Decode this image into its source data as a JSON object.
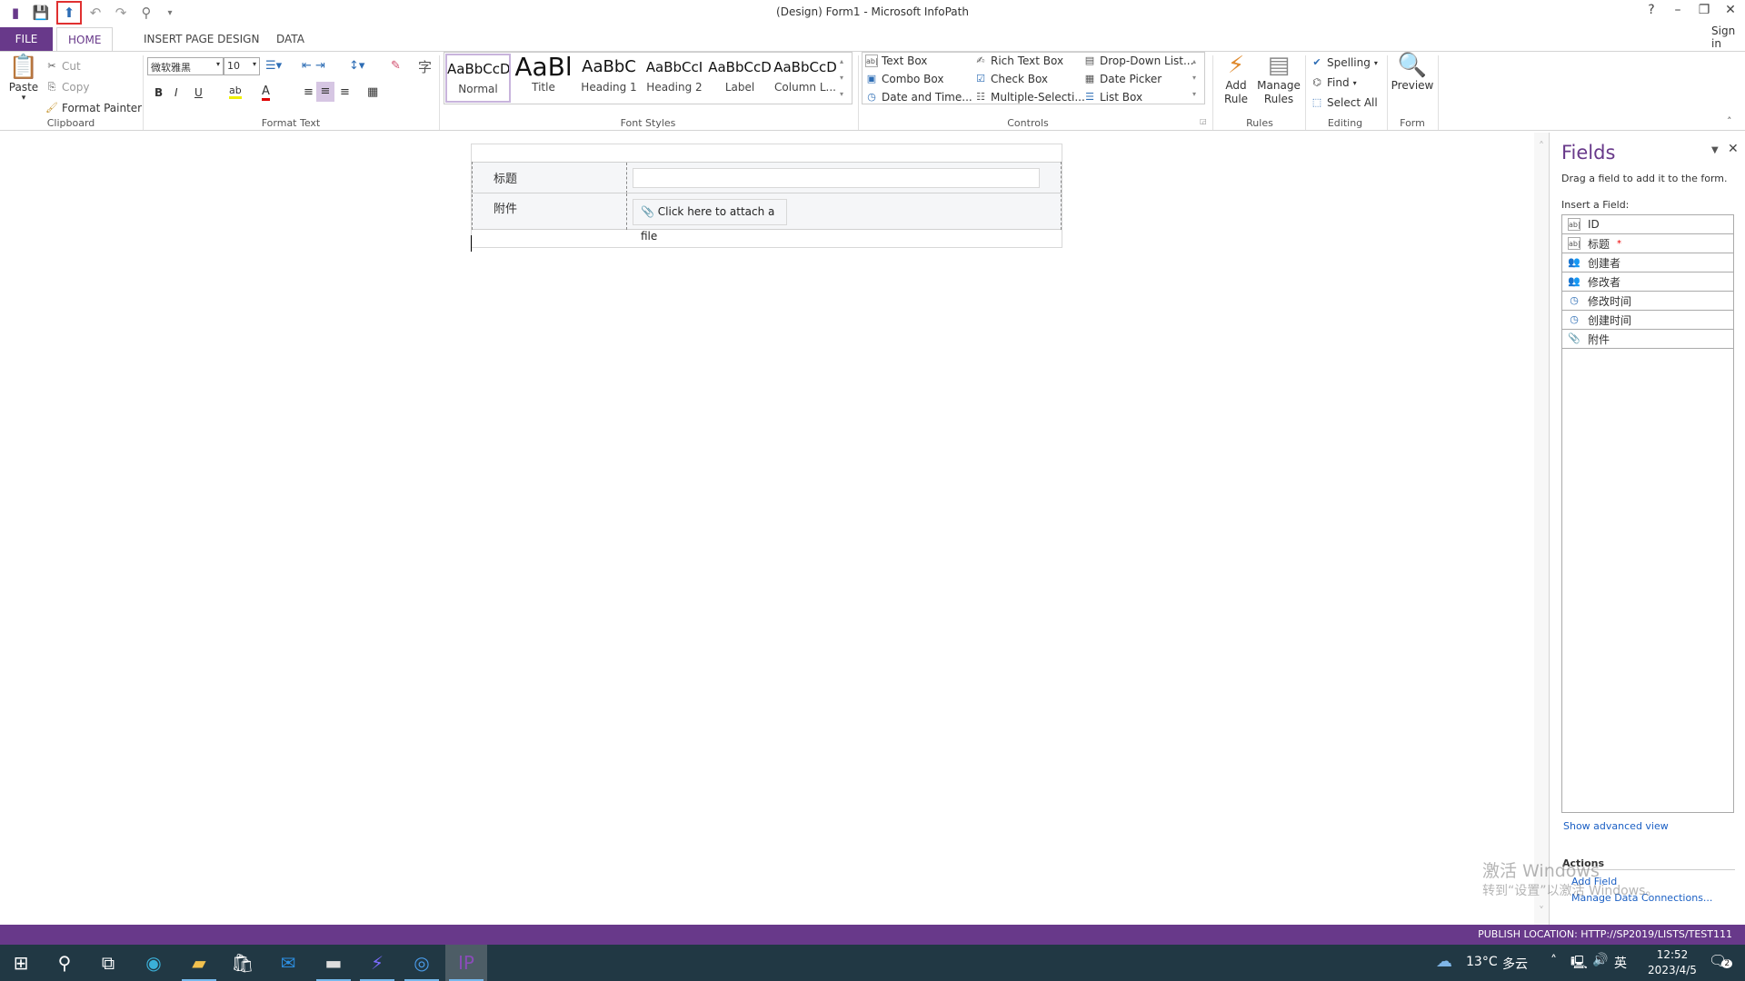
{
  "window": {
    "title": "(Design) Form1 - Microsoft InfoPath",
    "help": "?",
    "minimize": "–",
    "restore": "❐",
    "close": "✕",
    "sign_in": "Sign in"
  },
  "qat": {
    "icons": [
      "infopath-logo-icon",
      "save-icon",
      "publish-icon",
      "undo-icon",
      "redo-icon",
      "user-icon",
      "customize-icon"
    ],
    "highlight_color": "#e03030"
  },
  "tabs": [
    {
      "label": "FILE"
    },
    {
      "label": "HOME"
    },
    {
      "label": "INSERT"
    },
    {
      "label": "PAGE DESIGN"
    },
    {
      "label": "DATA"
    }
  ],
  "ribbon": {
    "clipboard": {
      "label": "Clipboard",
      "paste": "Paste",
      "cut": "Cut",
      "copy": "Copy",
      "format_painter": "Format Painter"
    },
    "format_text": {
      "label": "Format Text",
      "font": "微软雅黑",
      "size": "10",
      "bold": "B",
      "italic": "I",
      "underline": "U"
    },
    "font_styles": {
      "label": "Font Styles",
      "items": [
        {
          "sample": "AaBbCcD",
          "name": "Normal"
        },
        {
          "sample": "AaBl",
          "name": "Title"
        },
        {
          "sample": "AaBbC",
          "name": "Heading 1"
        },
        {
          "sample": "AaBbCcI",
          "name": "Heading 2"
        },
        {
          "sample": "AaBbCcD",
          "name": "Label"
        },
        {
          "sample": "AaBbCcD",
          "name": "Column L..."
        }
      ]
    },
    "controls": {
      "label": "Controls",
      "items": [
        "Text Box",
        "Rich Text Box",
        "Drop-Down List...",
        "Combo Box",
        "Check Box",
        "Date Picker",
        "Date and Time...",
        "Multiple-Selecti...",
        "List Box"
      ]
    },
    "rules": {
      "label": "Rules",
      "add_rule": "Add Rule",
      "manage_rules": "Manage Rules"
    },
    "editing": {
      "label": "Editing",
      "spelling": "Spelling",
      "find": "Find",
      "select_all": "Select All"
    },
    "form": {
      "label": "Form",
      "preview": "Preview"
    }
  },
  "form": {
    "rows": [
      {
        "label": "标题"
      },
      {
        "label": "附件",
        "attach": "Click here to attach a file"
      }
    ]
  },
  "fields_pane": {
    "title": "Fields",
    "hint": "Drag a field to add it to the form.",
    "insert_label": "Insert a Field:",
    "items": [
      {
        "name": "ID",
        "icon": "textbox-icon"
      },
      {
        "name": "标题",
        "icon": "textbox-icon",
        "required": "*"
      },
      {
        "name": "创建者",
        "icon": "people-icon"
      },
      {
        "name": "修改者",
        "icon": "people-icon"
      },
      {
        "name": "修改时间",
        "icon": "datetime-icon"
      },
      {
        "name": "创建时间",
        "icon": "datetime-icon"
      },
      {
        "name": "附件",
        "icon": "paperclip-icon"
      }
    ],
    "show_advanced": "Show advanced view",
    "actions_label": "Actions",
    "add_field": "Add Field",
    "manage_connections": "Manage Data Connections..."
  },
  "watermark": {
    "line1": "激活 Windows",
    "line2": "转到“设置”以激活 Windows。"
  },
  "status": {
    "publish_location": "PUBLISH LOCATION: HTTP://SP2019/LISTS/TEST111"
  },
  "taskbar": {
    "weather": "13°C",
    "weather_desc": "多云",
    "ime": "英",
    "time": "12:52",
    "date": "2023/4/5",
    "notifications": "2"
  }
}
